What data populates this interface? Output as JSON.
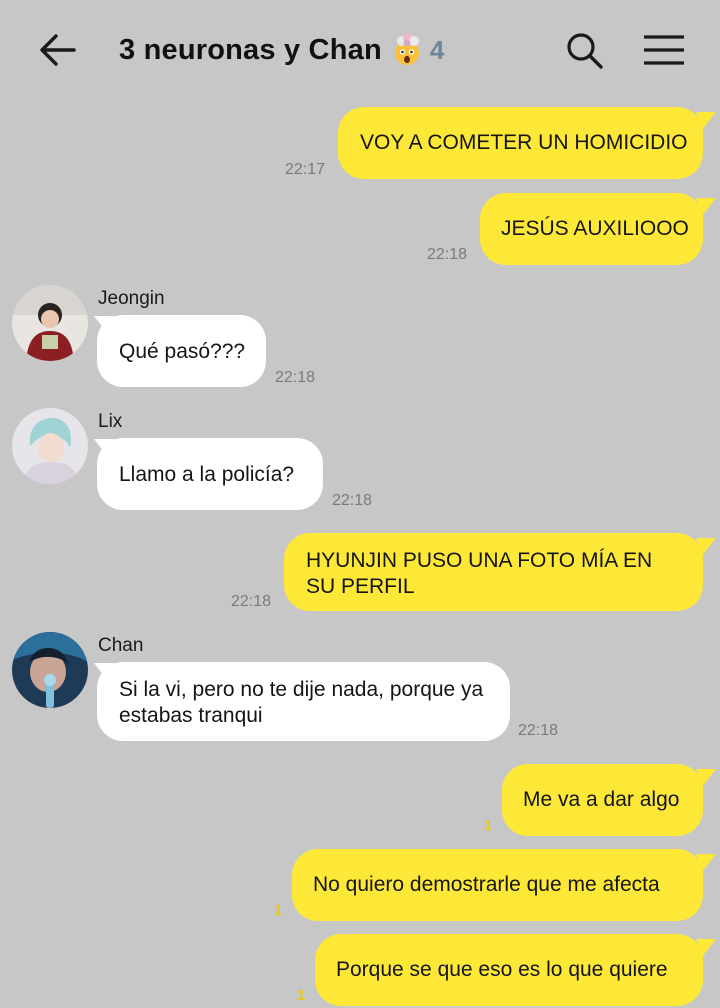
{
  "header": {
    "title": "3 neuronas y Chan",
    "member_count": "4",
    "back_icon": "arrow-left-icon",
    "emoji_icon": "exploding-head-emoji",
    "search_icon": "search-icon",
    "menu_icon": "hamburger-menu-icon"
  },
  "messages": [
    {
      "side": "me",
      "text": "VOY A COMETER UN HOMICIDIO",
      "time": "22:17"
    },
    {
      "side": "me",
      "text": "JESÚS AUXILIOOO",
      "time": "22:18"
    },
    {
      "side": "them",
      "sender": "Jeongin",
      "text": "Qué pasó???",
      "time": "22:18"
    },
    {
      "side": "them",
      "sender": "Lix",
      "text": "Llamo a la policía?",
      "time": "22:18"
    },
    {
      "side": "me",
      "text": "HYUNJIN PUSO UNA FOTO MÍA EN SU PERFIL",
      "time": "22:18"
    },
    {
      "side": "them",
      "sender": "Chan",
      "text": "Si la vi, pero no te dije nada, porque ya estabas tranqui",
      "time": "22:18"
    },
    {
      "side": "me",
      "text": "Me va a dar algo",
      "unread": "1"
    },
    {
      "side": "me",
      "text": "No quiero demostrarle que me afecta",
      "unread": "1"
    },
    {
      "side": "me",
      "text": "Porque se que eso es lo que quiere",
      "unread": "1"
    }
  ],
  "colors": {
    "background": "#c7c7c7",
    "my_bubble": "#fde838",
    "their_bubble": "#ffffff",
    "unread_count": "#e8c81a"
  }
}
